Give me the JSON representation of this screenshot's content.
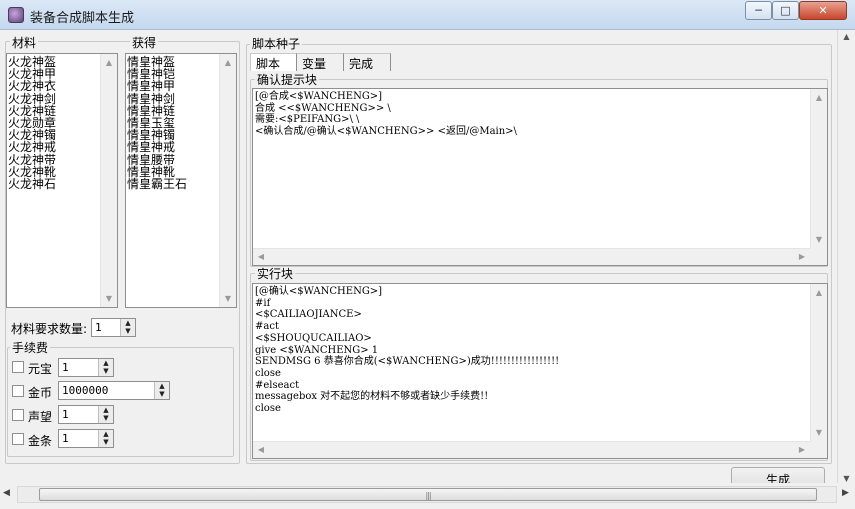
{
  "window": {
    "title": "装备合成脚本生成",
    "controls": {
      "minimize": "─",
      "maximize": "□",
      "close": "✕"
    }
  },
  "materials": {
    "label": "材料",
    "items": [
      "火龙神盔",
      "火龙神甲",
      "火龙神衣",
      "火龙神剑",
      "火龙神链",
      "火龙勋章",
      "火龙神镯",
      "火龙神戒",
      "火龙神带",
      "火龙神靴",
      "火龙神石"
    ]
  },
  "obtained": {
    "label": "获得",
    "items": [
      "情皇神盔",
      "情皇神铠",
      "情皇神甲",
      "情皇神剑",
      "情皇神链",
      "情皇玉玺",
      "情皇神镯",
      "情皇神戒",
      "情皇腰带",
      "情皇神靴",
      "情皇霸王石"
    ]
  },
  "material_quantity": {
    "label": "材料要求数量:",
    "value": "1"
  },
  "fees": {
    "label": "手续费",
    "rows": [
      {
        "label": "元宝",
        "value": "1"
      },
      {
        "label": "金币",
        "value": "1000000"
      },
      {
        "label": "声望",
        "value": "1"
      },
      {
        "label": "金条",
        "value": "1"
      }
    ]
  },
  "script_seed": {
    "label": "脚本种子",
    "tabs": [
      "脚本",
      "变量",
      "完成"
    ]
  },
  "confirm_block": {
    "label": "确认提示块",
    "lines": [
      "[@合成<$WANCHENG>]",
      "合成 <<$WANCHENG>> \\",
      "需要:<$PEIFANG>\\ \\",
      "<确认合成/@确认<$WANCHENG>> <返回/@Main>\\"
    ]
  },
  "exec_block": {
    "label": "实行块",
    "lines": [
      "[@确认<$WANCHENG>]",
      "#if",
      "<$CAILIAOJIANCE>",
      "#act",
      "<$SHOUQUCAILIAO>",
      "give <$WANCHENG> 1",
      "SENDMSG 6 恭喜你合成(<$WANCHENG>)成功!!!!!!!!!!!!!!!!!",
      "close",
      "#elseact",
      "messagebox 对不起您的材料不够或者缺少手续费!!",
      "close"
    ]
  },
  "generate": {
    "label": "生成"
  }
}
